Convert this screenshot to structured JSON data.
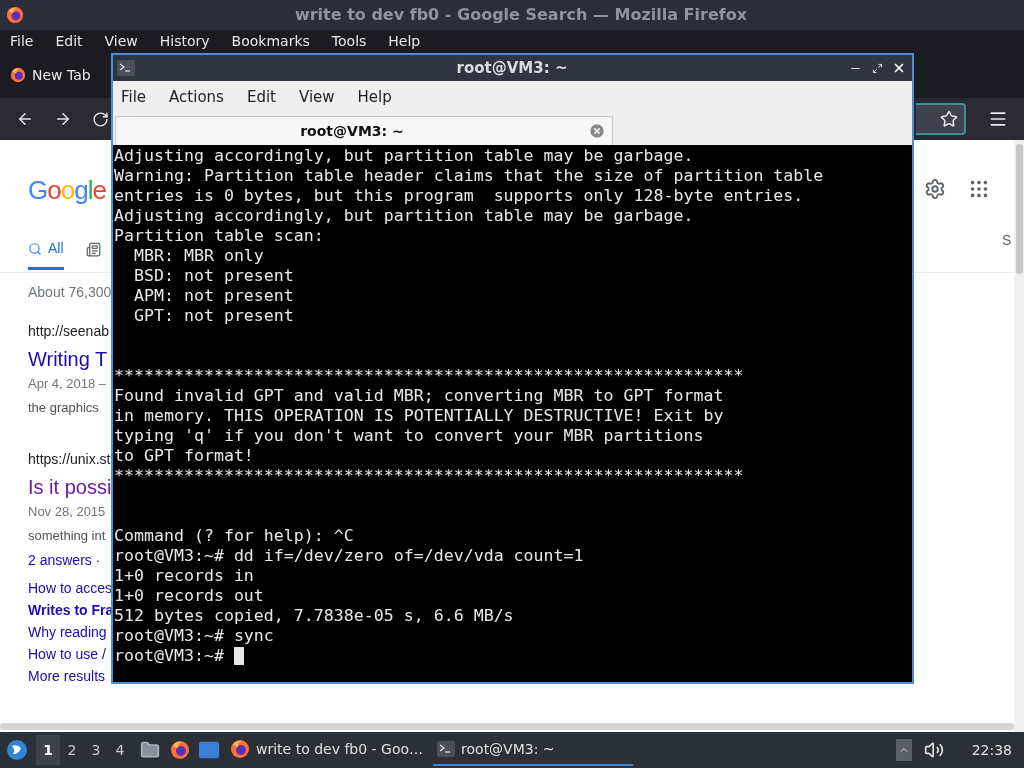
{
  "browser": {
    "title": "write to dev fb0 - Google Search — Mozilla Firefox",
    "menu": [
      "File",
      "Edit",
      "View",
      "History",
      "Bookmarks",
      "Tools",
      "Help"
    ],
    "tab": {
      "label": "New Tab"
    },
    "logo": "Google",
    "search_tabs": [
      {
        "label": "All",
        "selected": true
      }
    ],
    "result_stats": "About 76,300",
    "results": [
      {
        "url": "http://seenab",
        "title": "Writing T",
        "visited": false,
        "date": "Apr 4, 2018 –",
        "snippet": "the graphics"
      },
      {
        "url": "https://unix.st",
        "title": "Is it possi",
        "visited": true,
        "date": "Nov 28, 2015",
        "snippet": "something int",
        "answers": "2 answers ·",
        "links": [
          {
            "text": "How to acces",
            "bold": false
          },
          {
            "text": "Writes to Fra",
            "bold": true
          },
          {
            "text": "Why reading",
            "bold": false
          },
          {
            "text": "How to use /",
            "bold": false
          },
          {
            "text": "More results",
            "bold": false
          }
        ]
      }
    ],
    "right_tab": "S"
  },
  "terminal": {
    "title": "root@VM3: ~",
    "menu": [
      "File",
      "Actions",
      "Edit",
      "View",
      "Help"
    ],
    "tab": {
      "label": "root@VM3: ~"
    },
    "blocks": [
      [
        "Adjusting accordingly, but partition table may be garbage.",
        "Warning: Partition table header claims that the size of partition table",
        "entries is 0 bytes, but this program  supports only 128-byte entries.",
        "Adjusting accordingly, but partition table may be garbage.",
        "Partition table scan:",
        "  MBR: MBR only",
        "  BSD: not present",
        "  APM: not present",
        "  GPT: not present"
      ],
      [
        "***************************************************************",
        "Found invalid GPT and valid MBR; converting MBR to GPT format",
        "in memory. THIS OPERATION IS POTENTIALLY DESTRUCTIVE! Exit by",
        "typing 'q' if you don't want to convert your MBR partitions",
        "to GPT format!",
        "***************************************************************"
      ],
      [
        "Command (? for help): ^C",
        "root@VM3:~# dd if=/dev/zero of=/dev/vda count=1",
        "1+0 records in",
        "1+0 records out",
        "512 bytes copied, 7.7838e-05 s, 6.6 MB/s",
        "root@VM3:~# sync",
        "root@VM3:~#"
      ]
    ]
  },
  "taskbar": {
    "workspaces": [
      {
        "label": "1",
        "selected": true
      },
      {
        "label": "2",
        "selected": false
      },
      {
        "label": "3",
        "selected": false
      },
      {
        "label": "4",
        "selected": false
      }
    ],
    "tasks": [
      {
        "label": "write to dev fb0 - Goo…",
        "kind": "browser",
        "selected": false
      },
      {
        "label": "root@VM3: ~",
        "kind": "terminal",
        "selected": true
      }
    ],
    "clock": "22:38"
  }
}
